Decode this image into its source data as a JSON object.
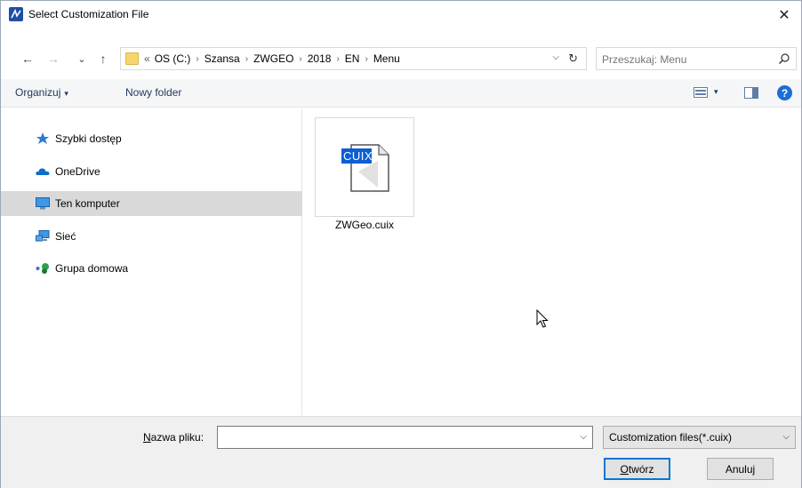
{
  "window": {
    "title": "Select Customization File",
    "close_glyph": "✕"
  },
  "nav": {
    "back_glyph": "←",
    "forward_glyph": "→",
    "recent_glyph": "⌄",
    "up_glyph": "↑"
  },
  "address": {
    "overflow": "«",
    "crumbs": [
      "OS (C:)",
      "Szansa",
      "ZWGEO",
      "2018",
      "EN",
      "Menu"
    ],
    "separator": "›",
    "dropdown_glyph": "⌵",
    "refresh_glyph": "↻"
  },
  "search": {
    "placeholder": "Przeszukaj: Menu"
  },
  "toolbar": {
    "organize_label": "Organizuj",
    "organize_caret": "▾",
    "new_folder_label": "Nowy folder",
    "view_caret": "▾",
    "help_glyph": "?"
  },
  "sidebar": {
    "items": [
      {
        "label": "Szybki dostęp",
        "icon": "star-pin-icon"
      },
      {
        "label": "OneDrive",
        "icon": "cloud-icon"
      },
      {
        "label": "Ten komputer",
        "icon": "computer-icon",
        "selected": true
      },
      {
        "label": "Sieć",
        "icon": "network-icon"
      },
      {
        "label": "Grupa domowa",
        "icon": "homegroup-icon"
      }
    ]
  },
  "files": [
    {
      "name": "ZWGeo.cuix",
      "badge": "CUIX"
    }
  ],
  "footer": {
    "filename_label_prefix": "",
    "filename_label_underlined": "N",
    "filename_label_rest": "azwa pliku:",
    "filename_value": "",
    "filename_dd_glyph": "⌵",
    "filter_value": "Customization files(*.cuix)",
    "filter_dd_glyph": "⌵",
    "open_underlined": "O",
    "open_rest": "twórz",
    "cancel_label": "Anuluj"
  },
  "colors": {
    "accent": "#0078d7",
    "selection": "#d9d9d9",
    "toolbar_text": "#1e395b",
    "cuix_badge": "#0b5fd3"
  }
}
